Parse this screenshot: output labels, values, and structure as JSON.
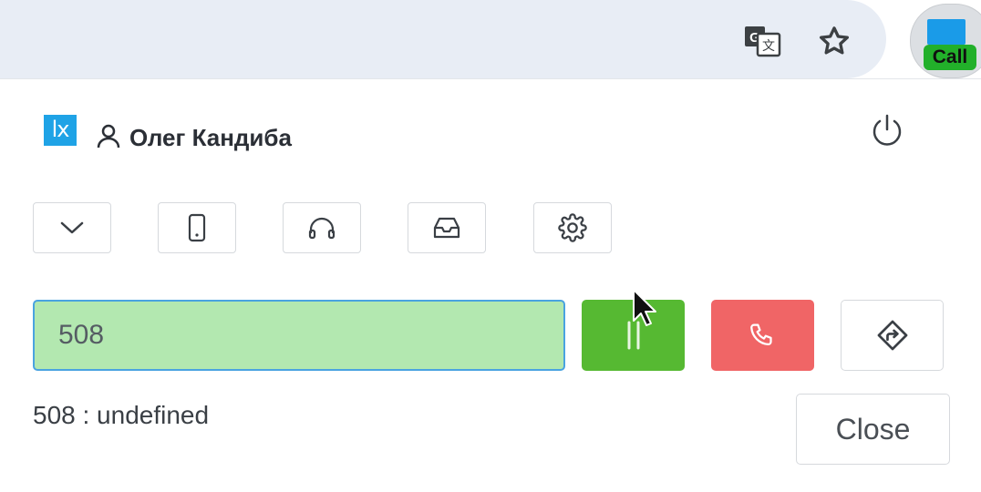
{
  "browser": {
    "extension_badge": "Call",
    "icons": [
      "translate-icon",
      "star-icon",
      "extension-icon"
    ]
  },
  "header": {
    "logo_text": "lx",
    "user_name": "Олег Кандиба",
    "icons": [
      "user-icon",
      "power-icon"
    ]
  },
  "toolbar": {
    "buttons": [
      {
        "name": "collapse",
        "icon": "chevron-down-icon"
      },
      {
        "name": "phone",
        "icon": "mobile-icon"
      },
      {
        "name": "headset",
        "icon": "headphones-icon"
      },
      {
        "name": "inbox",
        "icon": "inbox-icon"
      },
      {
        "name": "settings",
        "icon": "gear-icon"
      }
    ]
  },
  "dial": {
    "number_value": "508",
    "hold_icon": "pause-icon",
    "hangup_icon": "phone-hangup-icon",
    "transfer_icon": "transfer-icon"
  },
  "status": {
    "text": "508 : undefined"
  },
  "actions": {
    "close_label": "Close"
  },
  "colors": {
    "input_bg": "#b3e8b0",
    "input_border": "#4aa3e0",
    "hold_green": "#56b932",
    "hangup_red": "#f06566",
    "logo_blue": "#1fa3e6",
    "badge_green": "#22b02a"
  }
}
